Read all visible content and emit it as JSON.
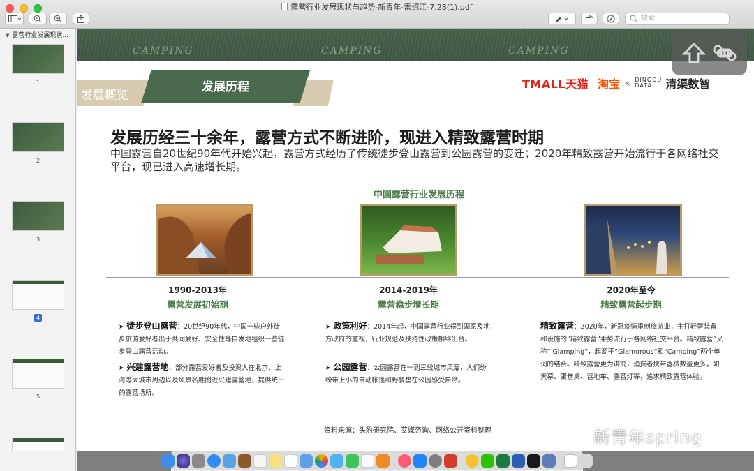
{
  "window": {
    "title": "露营行业发展现状与趋势-新青年-雷绍江-7.28(1).pdf"
  },
  "toolbar": {
    "search_placeholder": "搜索"
  },
  "sidebar": {
    "heading": "露营行业发展现状...",
    "pages": [
      {
        "number": "1",
        "style": "green",
        "selected": false
      },
      {
        "number": "2",
        "style": "green",
        "selected": false
      },
      {
        "number": "3",
        "style": "green",
        "selected": false
      },
      {
        "number": "4",
        "style": "white",
        "selected": true
      },
      {
        "number": "5",
        "style": "white",
        "selected": false
      }
    ]
  },
  "slide": {
    "banner_word": "CAMPING",
    "section_label": "发展概览",
    "tab_title": "发展历程",
    "logos": {
      "tmall": "TMALL天猫",
      "taobao": "淘宝",
      "times": "×",
      "dingou": "DINGOU DATA",
      "qingqu": "清渠数智"
    },
    "headline": "发展历经三十余年，露营方式不断进阶，现进入精致露营时期",
    "intro": "中国露营自20世纪90年代开始兴起，露营方式经历了传统徒步登山露营到公园露营的变迁；2020年精致露营开始流行于各网络社交平台，现已进入高速增长期。",
    "timeline_title": "中国露营行业发展历程",
    "eras": [
      {
        "years": "1990-2013年",
        "phase": "露营发展初始期",
        "items": [
          {
            "term": "徒步登山露营",
            "text": "20世纪90年代，中国一些户外徒步旅游爱好者出于共同爱好、安全性等自发地组织一些徒步登山露营活动。"
          },
          {
            "term": "兴建露营地",
            "text": "部分露营爱好者及投资人在北京、上海等大城市周边以及风景名胜附近兴建露营地，提供统一的露营场所。"
          }
        ]
      },
      {
        "years": "2014-2019年",
        "phase": "露营稳步增长期",
        "items": [
          {
            "term": "政策利好",
            "text": "2014年起，中国露营行业得到国家及地方政府的重视，行业规范及扶持性政策相继出台。"
          },
          {
            "term": "公园露营",
            "text": "公园露营在一到三线城市风靡，人们纷纷带上小的自动帐篷和野餐垫在公园感受自然。"
          }
        ]
      },
      {
        "years": "2020年至今",
        "phase": "精致露营起步期",
        "items": [
          {
            "term": "精致露营",
            "text": "2020年，新冠疫情重创旅游业，主打轻奢装备和设施的“精致露营”乘势流行于各网络社交平台。精致露营”又称” Glamping”，起源于“Glamorous”和“Camping”两个单词的结合。精致露营更为讲究，消费者携带器械数量更多，如天幕、蛋卷桌、营地车、露营灯等，追求精致露营体验。"
          }
        ]
      }
    ],
    "source": "资料来源：头豹研究院、艾媒咨询、网络公开资料整理",
    "watermark": "新青年spring"
  },
  "colors": {
    "accent_green": "#4b7a4a",
    "banner_green": "#48624b",
    "tan": "#d8c9b1",
    "tmall_red": "#e2231a",
    "taobao_orange": "#ff5000"
  }
}
